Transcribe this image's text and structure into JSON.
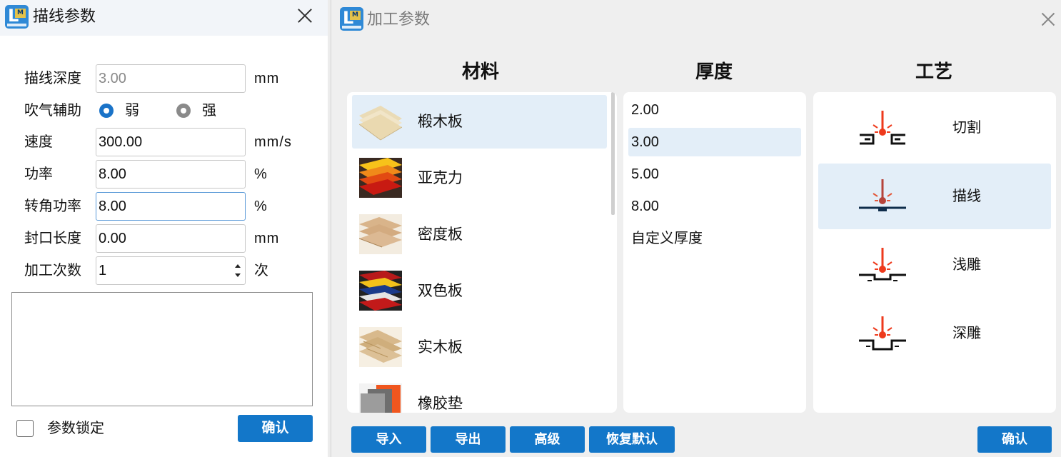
{
  "left_dialog": {
    "title": "描线参数",
    "fields": {
      "depth": {
        "label": "描线深度",
        "value": "3.00",
        "unit": "mm"
      },
      "air_assist": {
        "label": "吹气辅助",
        "option_weak": "弱",
        "option_strong": "强",
        "selected": "弱"
      },
      "speed": {
        "label": "速度",
        "value": "300.00",
        "unit": "mm/s"
      },
      "power": {
        "label": "功率",
        "value": "8.00",
        "unit": "%"
      },
      "corner_power": {
        "label": "转角功率",
        "value": "8.00",
        "unit": "%"
      },
      "seal_length": {
        "label": "封口长度",
        "value": "0.00",
        "unit": "mm"
      },
      "passes": {
        "label": "加工次数",
        "value": "1",
        "unit": "次"
      }
    },
    "notes": "",
    "lock_label": "参数锁定",
    "lock_checked": false,
    "confirm_label": "确认"
  },
  "right_dialog": {
    "title": "加工参数",
    "headers": {
      "material": "材料",
      "thickness": "厚度",
      "process": "工艺"
    },
    "materials": [
      {
        "name": "椴木板",
        "selected": true
      },
      {
        "name": "亚克力",
        "selected": false
      },
      {
        "name": "密度板",
        "selected": false
      },
      {
        "name": "双色板",
        "selected": false
      },
      {
        "name": "实木板",
        "selected": false
      },
      {
        "name": "橡胶垫",
        "selected": false
      }
    ],
    "thicknesses": [
      {
        "label": "2.00",
        "selected": false
      },
      {
        "label": "3.00",
        "selected": true
      },
      {
        "label": "5.00",
        "selected": false
      },
      {
        "label": "8.00",
        "selected": false
      },
      {
        "label": "自定义厚度",
        "selected": false
      }
    ],
    "processes": [
      {
        "name": "切割",
        "icon": "laser-cut-icon",
        "selected": false
      },
      {
        "name": "描线",
        "icon": "laser-line-icon",
        "selected": true
      },
      {
        "name": "浅雕",
        "icon": "laser-shallow-engrave-icon",
        "selected": false
      },
      {
        "name": "深雕",
        "icon": "laser-deep-engrave-icon",
        "selected": false
      }
    ],
    "buttons": {
      "import": "导入",
      "export": "导出",
      "advanced": "高级",
      "restore_default": "恢复默认",
      "confirm": "确认"
    }
  },
  "colors": {
    "accent": "#1377c9",
    "selection": "#e3eef8",
    "laser_red": "#ee3a1c",
    "laser_dark": "#b5433a"
  }
}
